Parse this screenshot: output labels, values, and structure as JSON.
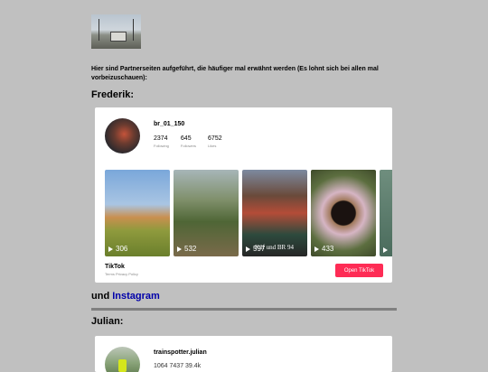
{
  "intro": "Hier sind Partnerseiten aufgeführt, die häufiger mal erwähnt werden (Es lohnt sich bei allen mal vorbeizuschauen):",
  "frederik": {
    "heading": "Frederik:",
    "username": "br_01_150",
    "stats": [
      {
        "value": "2374",
        "label": "Following"
      },
      {
        "value": "645",
        "label": "Followers"
      },
      {
        "value": "6752",
        "label": "Likes"
      }
    ],
    "videos": [
      {
        "views": "306",
        "bg": "linear-gradient(180deg,#7aa7da 0%,#a9c5e3 40%,#c98f4f 55%,#8f9a3d 70%,#6a7f2c 100%)"
      },
      {
        "views": "532",
        "bg": "linear-gradient(180deg,#a7b6b8 0%,#7f8f6a 35%,#4f6636 60%,#7a6a4a 100%)"
      },
      {
        "views": "597",
        "bg": "linear-gradient(180deg,#7d8aa0 0%,#6a4a3a 30%,#b44c38 50%,#2d4a3d 75%,#262626 100%)",
        "text": "Köf und BR 94"
      },
      {
        "views": "433",
        "bg": "radial-gradient(circle at 50% 50%, #1a1210 0%, #1a1210 22%, #a17a5d 24%, #d6b5c4 40%, #5c6e3f 70%, #3e4a2a 100%)"
      },
      {
        "views": "",
        "bg": "linear-gradient(180deg,#6f8e7e 0%,#4a6b5c 100%)"
      }
    ],
    "brand": "TikTok",
    "links": "Terms  Privacy Policy",
    "open_button": "Open TikTok"
  },
  "und_prefix": "und",
  "und_link": "Instagram",
  "julian": {
    "heading": "Julian:",
    "username": "trainspotter.julian",
    "stats_partial": "1064  7437  39.4k"
  }
}
